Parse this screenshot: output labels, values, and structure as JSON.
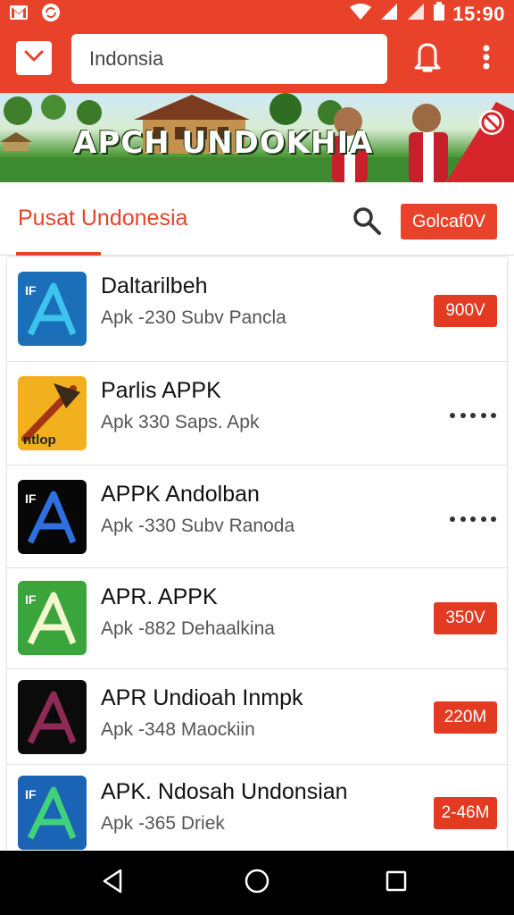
{
  "status_bar": {
    "time": "15:90"
  },
  "toolbar": {
    "search_value": "Indonsia"
  },
  "banner": {
    "title": "APCH UNDOKHIA"
  },
  "section": {
    "tab_label": "Pusat Undonesia",
    "action_label": "Golcaf0V"
  },
  "apps": [
    {
      "name": "Daltarilbeh",
      "meta": "Apk -230 Subv Pancla",
      "size": "900V",
      "action": "badge",
      "icon_bg": "#1a6fb8",
      "icon_fg": "#3cc4ee",
      "icon_text": "IF"
    },
    {
      "name": "Parlis APPK",
      "meta": "Apk 330 Saps. Apk",
      "size": "",
      "action": "menu",
      "icon_bg": "#f2b01e",
      "icon_fg": "#a23512",
      "icon_text": "ntlop"
    },
    {
      "name": "APPK Andolban",
      "meta": "Apk -330 Subv Ranoda",
      "size": "",
      "action": "menu",
      "icon_bg": "#070707",
      "icon_fg": "#2f6fe0",
      "icon_text": "IF"
    },
    {
      "name": "APR. APPK",
      "meta": "Apk -882 Dehaalkina",
      "size": "350V",
      "action": "badge",
      "icon_bg": "#3aa53a",
      "icon_fg": "#f3f7cf",
      "icon_text": "IF"
    },
    {
      "name": "APR Undioah Inmpk",
      "meta": "Apk -348 Maockiin",
      "size": "220M",
      "action": "badge",
      "icon_bg": "#0b0b0b",
      "icon_fg": "#8e2a55",
      "icon_text": ""
    },
    {
      "name": "APK. Ndosah Undonsian",
      "meta": "Apk -365 Driek",
      "size": "2-46M",
      "action": "badge",
      "icon_bg": "#1b63b5",
      "icon_fg": "#3fd27a",
      "icon_text": "IF"
    }
  ],
  "colors": {
    "accent": "#e8432a",
    "badge": "#e33b22"
  }
}
